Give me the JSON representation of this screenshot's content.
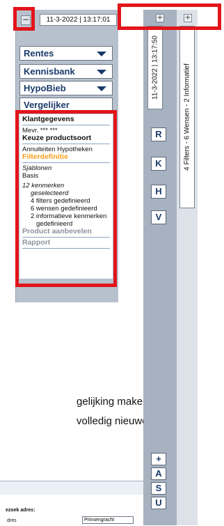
{
  "left": {
    "date": "11-3-2022 | 13:17:01",
    "nav": [
      {
        "label": "Rentes",
        "dropdown": true
      },
      {
        "label": "Kennisbank",
        "dropdown": true
      },
      {
        "label": "HypoBieb",
        "dropdown": true
      },
      {
        "label": "Vergelijker",
        "dropdown": false
      }
    ],
    "steps": {
      "klant": "Klantgegevens",
      "klant_name": "Mevr. *** ***",
      "keuze": "Keuze productsoort",
      "keuze_value": "Annuiteiten Hypotheken",
      "filter": "Filterdefinitie",
      "sjablonen": "Sjablonen",
      "basis": "Basis",
      "k1": "12  kenmerken",
      "k2": "geselecteerd",
      "k3": "4  filters gedefinieerd",
      "k4": "6  wensen gedefinieerd",
      "k5": "2  informatieve kenmerken",
      "k6": "gedefinieerd",
      "product": "Product aanbevelen",
      "rapport": "Rapport"
    }
  },
  "right": {
    "date_vertical": "11-3-2022 | 13:17:50",
    "summary_vertical": "4 Filters - 6 Wensen - 2 Informatief",
    "buttons_top": [
      "R",
      "K",
      "H",
      "V"
    ],
    "buttons_bottom": [
      "+",
      "A",
      "S",
      "U"
    ]
  },
  "content": {
    "line1": "gelijking maken",
    "line2": "volledig nieuwe",
    "search_label": "ezoek adres:",
    "adres_label": "dres",
    "adres_value": "Prinsengracht"
  },
  "colors": {
    "highlight": "#e2141a",
    "accent": "#1a3a6b",
    "orange": "#f5a01a"
  }
}
